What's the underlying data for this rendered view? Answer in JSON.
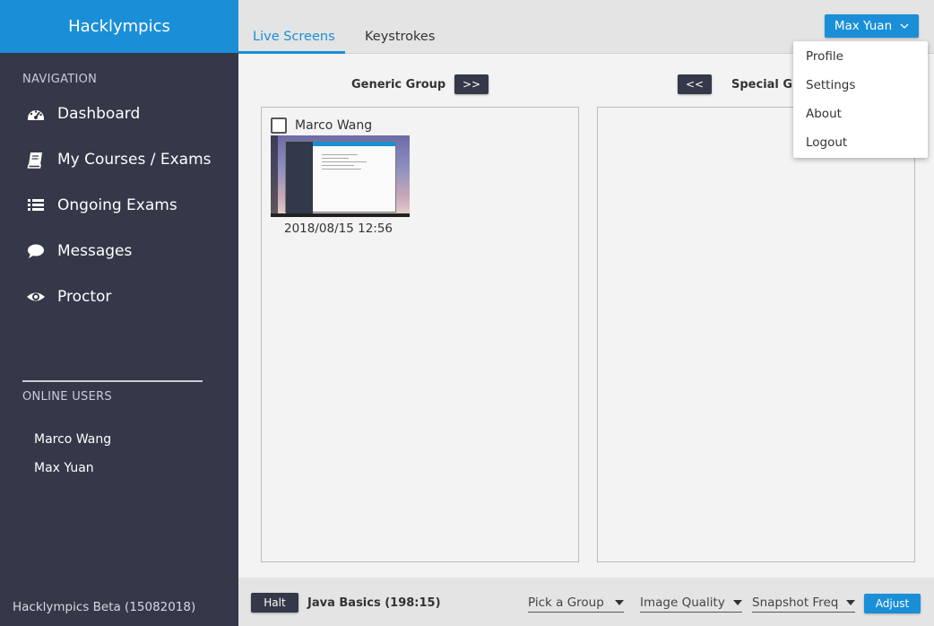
{
  "app": {
    "title": "Hacklympics",
    "version": "Hacklympics Beta (15082018)"
  },
  "sidebar": {
    "nav_heading": "NAVIGATION",
    "items": [
      {
        "label": "Dashboard",
        "icon": "dashboard-icon"
      },
      {
        "label": "My Courses / Exams",
        "icon": "book-icon"
      },
      {
        "label": "Ongoing Exams",
        "icon": "list-icon"
      },
      {
        "label": "Messages",
        "icon": "chat-bubble-icon"
      },
      {
        "label": "Proctor",
        "icon": "eye-icon"
      }
    ],
    "users_heading": "ONLINE USERS",
    "online_users": [
      "Marco Wang",
      "Max Yuan"
    ]
  },
  "tabs": [
    {
      "label": "Live Screens",
      "active": true
    },
    {
      "label": "Keystrokes",
      "active": false
    }
  ],
  "user_menu": {
    "button_label": "Max Yuan",
    "items": [
      "Profile",
      "Settings",
      "About",
      "Logout"
    ]
  },
  "groups": {
    "generic": {
      "title": "Generic Group",
      "move_label": ">>"
    },
    "special": {
      "title": "Special Gr",
      "move_label": "<<"
    }
  },
  "students": [
    {
      "name": "Marco Wang",
      "timestamp": "2018/08/15 12:56",
      "checked": false
    }
  ],
  "bottom": {
    "halt_label": "Halt",
    "exam_label": "Java Basics (198:15)",
    "pick_group": "Pick a Group",
    "image_quality": "Image Quality",
    "snapshot_freq": "Snapshot Freq",
    "adjust_label": "Adjust"
  },
  "colors": {
    "accent": "#1a8fd8",
    "sidebar": "#343848",
    "background": "#e4e4e4",
    "panel": "#f3f3f3"
  }
}
